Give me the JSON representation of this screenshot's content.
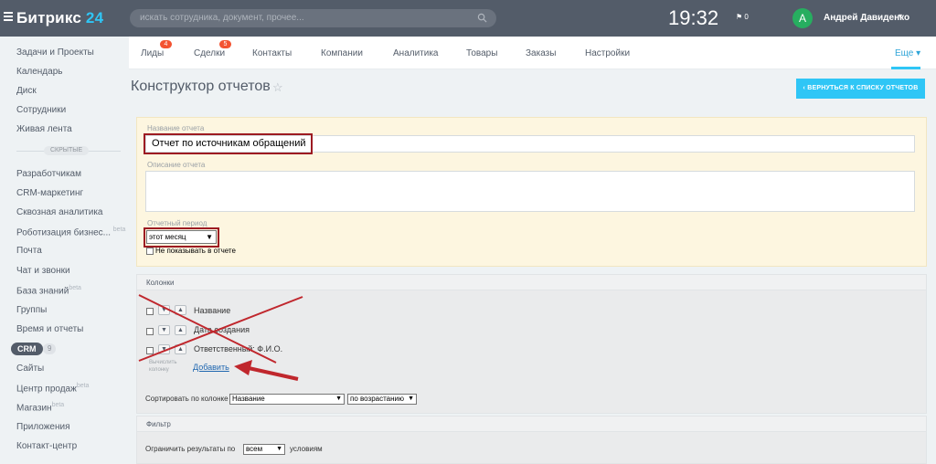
{
  "header": {
    "logo_text": "Битрикс",
    "logo_num": "24",
    "search_placeholder": "искать сотрудника, документ, прочее...",
    "clock": "19:32",
    "flag_count": "0",
    "avatar_letter": "А",
    "user_name": "Андрей Давиденко"
  },
  "sidebar": {
    "items": [
      "Задачи и Проекты",
      "Календарь",
      "Диск",
      "Сотрудники",
      "Живая лента"
    ],
    "hidden_label": "СКРЫТЫЕ",
    "hidden_items": [
      "Разработчикам",
      "CRM-маркетинг",
      "Сквозная аналитика",
      "Роботизация бизнес...",
      "Почта",
      "Чат и звонки",
      "База знаний",
      "Группы",
      "Время и отчеты"
    ],
    "beta": "beta",
    "crm_label": "CRM",
    "crm_count": "9",
    "after_crm": [
      "Сайты",
      "Центр продаж",
      "Магазин",
      "Приложения",
      "Контакт-центр"
    ]
  },
  "nav": {
    "tabs": [
      "Лиды",
      "Сделки",
      "Контакты",
      "Компании",
      "Аналитика",
      "Товары",
      "Заказы",
      "Настройки"
    ],
    "badges": {
      "leads": "4",
      "deals": "5"
    },
    "more_label": "Еще"
  },
  "page": {
    "title": "Конструктор отчетов",
    "back_button": "ВЕРНУТЬСЯ К СПИСКУ ОТЧЕТОВ"
  },
  "form": {
    "name_label": "Название отчета",
    "name_value": "Отчет по источникам обращений",
    "desc_label": "Описание отчета",
    "desc_value": "",
    "period_label": "Отчетный период",
    "period_value": "этот месяц",
    "hide_period_label": "Не показывать в отчете"
  },
  "columns": {
    "header": "Колонки",
    "rows": [
      "Название",
      "Дата создания",
      "Ответственный: Ф.И.О."
    ],
    "hint": "Вычислить колонку",
    "add_link": "Добавить",
    "sort_label": "Сортировать по колонке",
    "sort_column": "Название",
    "sort_order": "по возрастанию"
  },
  "filter": {
    "header": "Фильтр",
    "limit_label": "Ограничить результаты по",
    "limit_value": "всем",
    "cond_label": "условиям"
  },
  "colors": {
    "topbar": "#535c69",
    "accent": "#2fc6f6",
    "highlight": "#9d1b22",
    "annotation": "#c0272d"
  }
}
